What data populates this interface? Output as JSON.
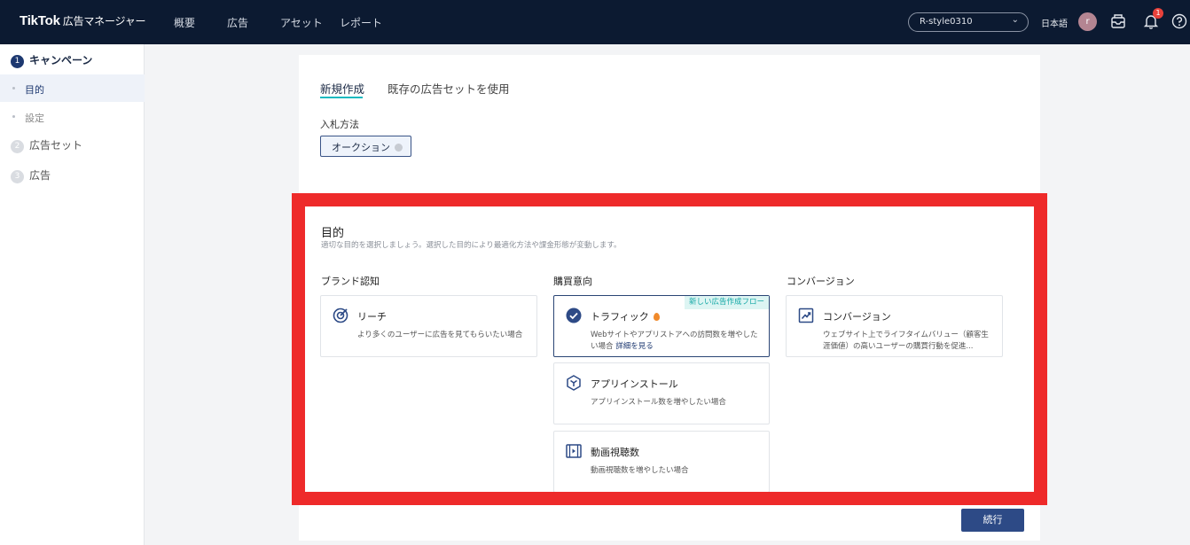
{
  "topbar": {
    "logo": "TikTok",
    "logo_sub": "広告マネージャー",
    "nav": [
      "概要",
      "広告",
      "アセット",
      "レポート"
    ],
    "account": "R-style0310",
    "language": "日本語",
    "avatar_letter": "r",
    "notification_count": "1",
    "icons": [
      "chevron-down-icon",
      "inbox-icon",
      "bell-icon",
      "help-icon"
    ]
  },
  "sidebar": {
    "step1": {
      "num": "1",
      "label": "キャンペーン"
    },
    "sub1": "目的",
    "sub2": "設定",
    "step2": {
      "num": "2",
      "label": "広告セット"
    },
    "step3": {
      "num": "3",
      "label": "広告"
    }
  },
  "create": {
    "tab_new": "新規作成",
    "tab_existing": "既存の広告セットを使用",
    "bid_label": "入札方法",
    "bid_value": "オークション"
  },
  "objective": {
    "title": "目的",
    "description": "適切な目的を選択しましょう。選択した目的により最適化方法や課金形態が変動します。",
    "columns": [
      "ブランド認知",
      "購買意向",
      "コンバージョン"
    ],
    "reach": {
      "title": "リーチ",
      "desc": "より多くのユーザーに広告を見てもらいたい場合"
    },
    "traffic": {
      "title": "トラフィック",
      "desc": "Webサイトやアプリストアへの訪問数を増やしたい場合",
      "more": "詳細を見る",
      "flag": "新しい広告作成フロー"
    },
    "app_install": {
      "title": "アプリインストール",
      "desc": "アプリインストール数を増やしたい場合"
    },
    "video_views": {
      "title": "動画視聴数",
      "desc": "動画視聴数を増やしたい場合"
    },
    "conversion": {
      "title": "コンバージョン",
      "desc": "ウェブサイト上でライフタイムバリュー（顧客生涯価値）の高いユーザーの購買行動を促進..."
    }
  },
  "footer": {
    "continue": "続行"
  },
  "colors": {
    "topbar": "#0c1a31",
    "primary": "#2d4a86",
    "accent": "#16b9c0",
    "highlight": "#ee2a2a"
  }
}
